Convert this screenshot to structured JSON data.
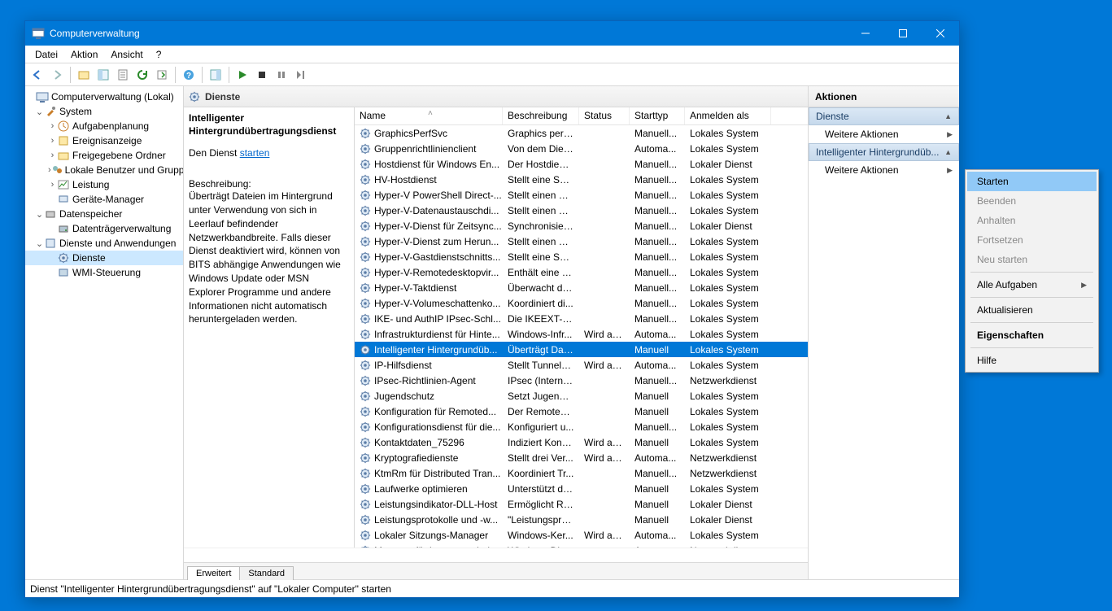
{
  "window": {
    "title": "Computerverwaltung"
  },
  "menu": {
    "file": "Datei",
    "action": "Aktion",
    "view": "Ansicht",
    "help": "?"
  },
  "tree": {
    "root": "Computerverwaltung (Lokal)",
    "system": "System",
    "sched": "Aufgabenplanung",
    "event": "Ereignisanzeige",
    "shared": "Freigegebene Ordner",
    "users": "Lokale Benutzer und Gruppen",
    "perf": "Leistung",
    "devmgr": "Geräte-Manager",
    "storage": "Datenspeicher",
    "disk": "Datenträgerverwaltung",
    "svcapps": "Dienste und Anwendungen",
    "services": "Dienste",
    "wmi": "WMI-Steuerung"
  },
  "services_header": "Dienste",
  "detail": {
    "name": "Intelligenter Hintergrundübertragungsdienst",
    "action_prefix": "Den Dienst ",
    "action_link": "starten",
    "desc_label": "Beschreibung:",
    "desc_text": "Überträgt Dateien im Hintergrund unter Verwendung von sich in Leerlauf befindender Netzwerkbandbreite. Falls dieser Dienst deaktiviert wird, können von BITS abhängige Anwendungen wie Windows Update oder MSN Explorer Programme und andere Informationen nicht automatisch heruntergeladen werden."
  },
  "columns": {
    "name": "Name",
    "desc": "Beschreibung",
    "status": "Status",
    "startup": "Starttyp",
    "logon": "Anmelden als"
  },
  "rows": [
    {
      "n": "GraphicsPerfSvc",
      "d": "Graphics perf...",
      "s": "",
      "t": "Manuell...",
      "l": "Lokales System"
    },
    {
      "n": "Gruppenrichtlinienclient",
      "d": "Von dem Dien...",
      "s": "",
      "t": "Automa...",
      "l": "Lokales System"
    },
    {
      "n": "Hostdienst für Windows En...",
      "d": "Der Hostdiens...",
      "s": "",
      "t": "Manuell...",
      "l": "Lokaler Dienst"
    },
    {
      "n": "HV-Hostdienst",
      "d": "Stellt eine Sch...",
      "s": "",
      "t": "Manuell...",
      "l": "Lokales System"
    },
    {
      "n": "Hyper-V PowerShell Direct-...",
      "d": "Stellt einen M...",
      "s": "",
      "t": "Manuell...",
      "l": "Lokales System"
    },
    {
      "n": "Hyper-V-Datenaustauschdi...",
      "d": "Stellt einen M...",
      "s": "",
      "t": "Manuell...",
      "l": "Lokales System"
    },
    {
      "n": "Hyper-V-Dienst für Zeitsync...",
      "d": "Synchronisiert...",
      "s": "",
      "t": "Manuell...",
      "l": "Lokaler Dienst"
    },
    {
      "n": "Hyper-V-Dienst zum Herun...",
      "d": "Stellt einen M...",
      "s": "",
      "t": "Manuell...",
      "l": "Lokales System"
    },
    {
      "n": "Hyper-V-Gastdienstschnitts...",
      "d": "Stellt eine Sch...",
      "s": "",
      "t": "Manuell...",
      "l": "Lokales System"
    },
    {
      "n": "Hyper-V-Remotedesktopvir...",
      "d": "Enthält eine Pl...",
      "s": "",
      "t": "Manuell...",
      "l": "Lokales System"
    },
    {
      "n": "Hyper-V-Taktdienst",
      "d": "Überwacht de...",
      "s": "",
      "t": "Manuell...",
      "l": "Lokales System"
    },
    {
      "n": "Hyper-V-Volumeschattenko...",
      "d": "Koordiniert di...",
      "s": "",
      "t": "Manuell...",
      "l": "Lokales System"
    },
    {
      "n": "IKE- und AuthIP IPsec-Schl...",
      "d": "Die IKEEXT-Di...",
      "s": "",
      "t": "Manuell...",
      "l": "Lokales System"
    },
    {
      "n": "Infrastrukturdienst für Hinte...",
      "d": "Windows-Infr...",
      "s": "Wird au...",
      "t": "Automa...",
      "l": "Lokales System"
    },
    {
      "n": "Intelligenter Hintergrundüb...",
      "d": "Überträgt Dat...",
      "s": "",
      "t": "Manuell",
      "l": "Lokales System",
      "sel": true
    },
    {
      "n": "IP-Hilfsdienst",
      "d": "Stellt Tunnelk...",
      "s": "Wird au...",
      "t": "Automa...",
      "l": "Lokales System"
    },
    {
      "n": "IPsec-Richtlinien-Agent",
      "d": "IPsec (Internet...",
      "s": "",
      "t": "Manuell...",
      "l": "Netzwerkdienst"
    },
    {
      "n": "Jugendschutz",
      "d": "Setzt Jugends...",
      "s": "",
      "t": "Manuell",
      "l": "Lokales System"
    },
    {
      "n": "Konfiguration für Remoted...",
      "d": "Der Remotede...",
      "s": "",
      "t": "Manuell",
      "l": "Lokales System"
    },
    {
      "n": "Konfigurationsdienst für die...",
      "d": "Konfiguriert u...",
      "s": "",
      "t": "Manuell...",
      "l": "Lokales System"
    },
    {
      "n": "Kontaktdaten_75296",
      "d": "Indiziert Konta...",
      "s": "Wird au...",
      "t": "Manuell",
      "l": "Lokales System"
    },
    {
      "n": "Kryptografiedienste",
      "d": "Stellt drei Ver...",
      "s": "Wird au...",
      "t": "Automa...",
      "l": "Netzwerkdienst"
    },
    {
      "n": "KtmRm für Distributed Tran...",
      "d": "Koordiniert Tr...",
      "s": "",
      "t": "Manuell...",
      "l": "Netzwerkdienst"
    },
    {
      "n": "Laufwerke optimieren",
      "d": "Unterstützt de...",
      "s": "",
      "t": "Manuell",
      "l": "Lokales System"
    },
    {
      "n": "Leistungsindikator-DLL-Host",
      "d": "Ermöglicht Re...",
      "s": "",
      "t": "Manuell",
      "l": "Lokaler Dienst"
    },
    {
      "n": "Leistungsprotokolle und -w...",
      "d": "\"Leistungspro...",
      "s": "",
      "t": "Manuell",
      "l": "Lokaler Dienst"
    },
    {
      "n": "Lokaler Sitzungs-Manager",
      "d": "Windows-Ker...",
      "s": "Wird au...",
      "t": "Automa...",
      "l": "Lokales System"
    },
    {
      "n": "Manager für heruntergelad...",
      "d": "Windows-Die...",
      "s": "",
      "t": "Automa...",
      "l": "Netzwerkdienst"
    }
  ],
  "tabs": {
    "ext": "Erweitert",
    "std": "Standard"
  },
  "actions": {
    "header": "Aktionen",
    "sect1": "Dienste",
    "more": "Weitere Aktionen",
    "sect2": "Intelligenter Hintergrundüb..."
  },
  "ctx": {
    "start": "Starten",
    "stop": "Beenden",
    "pause": "Anhalten",
    "resume": "Fortsetzen",
    "restart": "Neu starten",
    "alltasks": "Alle Aufgaben",
    "refresh": "Aktualisieren",
    "props": "Eigenschaften",
    "help": "Hilfe"
  },
  "statusbar": "Dienst \"Intelligenter Hintergrundübertragungsdienst\" auf \"Lokaler Computer\" starten"
}
